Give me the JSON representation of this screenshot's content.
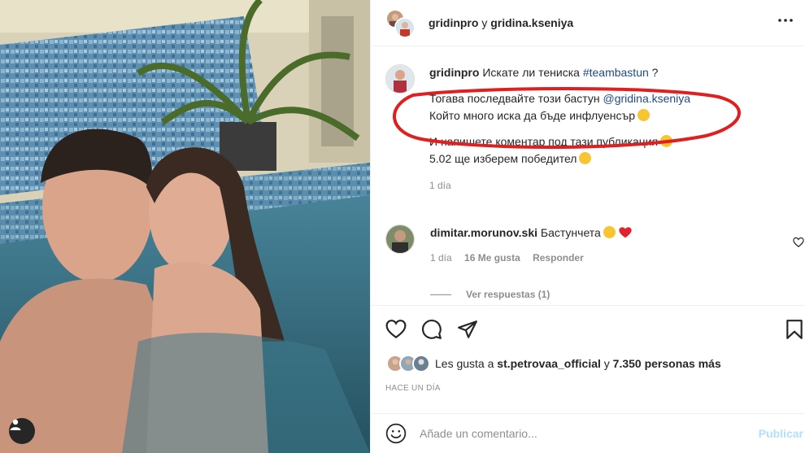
{
  "header": {
    "user1": "gridinpro",
    "connector": "y",
    "user2": "gridina.kseniya"
  },
  "caption": {
    "username": "gridinpro",
    "line1_text": "Искате ли тениска",
    "hashtag": "#teambastun",
    "line1_end": "?",
    "line2_text": "Тогава последвайте този бастун",
    "mention": "@gridina.kseniya",
    "line3_text": "Който много иска да бъде инфлуенсър",
    "line4_text": "И напишете коментар под тази публикация",
    "line5_text": "5.02 ще изберем победител",
    "time": "1 día"
  },
  "comment": {
    "username": "dimitar.morunov.ski",
    "text": "Бастунчета",
    "time": "1 día",
    "likes": "16 Me gusta",
    "reply": "Responder",
    "view_replies": "Ver respuestas (1)"
  },
  "likes": {
    "prefix": "Les gusta a",
    "user": "st.petrovaa_official",
    "middle": "y",
    "count": "7.350 personas más"
  },
  "timestamp": "HACE UN DÍA",
  "add_comment": {
    "placeholder": "Añade un comentario...",
    "publish": "Publicar"
  },
  "colors": {
    "link": "#1f4b85",
    "muted": "#8e8e8e",
    "publish_disabled": "#b2dffc",
    "annotation_red": "#e02020",
    "heart_red": "#ed4956"
  },
  "icons": [
    "user-tag-icon",
    "more-options-icon",
    "heart-icon",
    "comment-icon",
    "share-icon",
    "bookmark-icon",
    "emoji-icon"
  ]
}
